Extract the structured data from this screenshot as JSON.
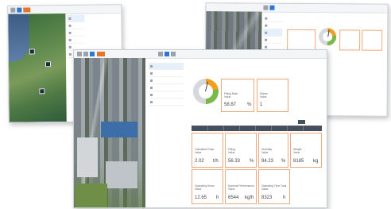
{
  "map_window": {
    "title_text": "",
    "brand_mark": "",
    "list_items": [
      "",
      "",
      "",
      "",
      "",
      ""
    ],
    "detail_heading": ""
  },
  "factory_window": {
    "list_items": [
      "",
      "",
      "",
      "",
      ""
    ],
    "tiles": [
      {
        "code": "",
        "label": "",
        "value": "",
        "unit": ""
      },
      {
        "code": "",
        "label": "",
        "value": "",
        "unit": ""
      },
      {
        "code": "",
        "label": "",
        "value": "",
        "unit": ""
      }
    ],
    "gauge_value": 0.55
  },
  "main_window": {
    "list_items": [
      {
        "label": ""
      },
      {
        "label": ""
      },
      {
        "label": ""
      },
      {
        "label": ""
      },
      {
        "label": ""
      },
      {
        "label": ""
      }
    ],
    "gauge_value": 0.58,
    "tiles_top": [
      {
        "code": "",
        "label": "Filling Rate\nValue",
        "value": "58.87",
        "unit": "%"
      },
      {
        "code": "",
        "label": "Status\nValue",
        "value": "1",
        "unit": ""
      }
    ],
    "tiles_row1": [
      {
        "code": "",
        "label": "Calculated Total\nValue",
        "value": "2.02",
        "unit": "t/h"
      },
      {
        "code": "",
        "label": "Filling\nValue",
        "value": "56.33",
        "unit": "%"
      },
      {
        "code": "",
        "label": "Humidity\nValue",
        "value": "94.23",
        "unit": "%"
      },
      {
        "code": "",
        "label": "Weight\nValue",
        "value": "8185",
        "unit": "kg"
      }
    ],
    "tiles_row2": [
      {
        "code": "",
        "label": "Operating Hours\nValue",
        "value": "12.65",
        "unit": "h"
      },
      {
        "code": "",
        "label": "Nominal Performance\nValue",
        "value": "6544",
        "unit": "kg/h"
      },
      {
        "code": "",
        "label": "Operating Time Total\nValue",
        "value": "8323",
        "unit": "h"
      }
    ]
  },
  "colors": {
    "accent_blue": "#2f76d2",
    "accent_orange": "#e8742a",
    "tile_border": "#f0a87a",
    "band_dark": "#45505c"
  }
}
